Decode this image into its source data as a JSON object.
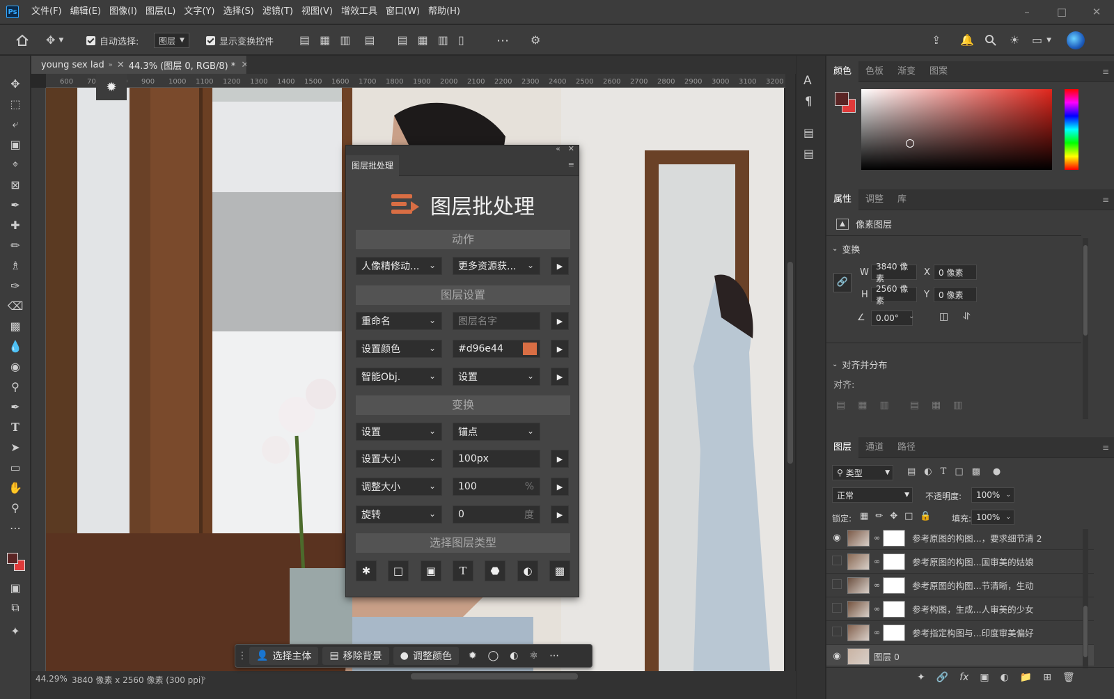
{
  "menubar": {
    "items": [
      "文件(F)",
      "编辑(E)",
      "图像(I)",
      "图层(L)",
      "文字(Y)",
      "选择(S)",
      "滤镜(T)",
      "视图(V)",
      "增效工具",
      "窗口(W)",
      "帮助(H)"
    ],
    "logo": "Ps"
  },
  "options": {
    "auto_select_label": "自动选择:",
    "auto_select_value": "图层",
    "show_transform_label": "显示变换控件"
  },
  "document": {
    "tab_title": "young sex lad",
    "tab_suffix": "44.3% (图层 0, RGB/8) *",
    "ruler_ticks": [
      "600",
      "700",
      "800",
      "900",
      "1000",
      "1100",
      "1200",
      "1300",
      "1400",
      "1500",
      "1600",
      "1700",
      "1800",
      "1900",
      "2000",
      "2100",
      "2200",
      "2300",
      "2400",
      "2500",
      "2600",
      "2700",
      "2800",
      "2900",
      "3000",
      "3100",
      "3200"
    ],
    "zoom": "44.29%",
    "dimensions": "3840 像素 x 2560 像素 (300 ppi)"
  },
  "context_bar": {
    "select_subject": "选择主体",
    "remove_bg": "移除背景",
    "adjust_color": "调整颜色"
  },
  "plugin": {
    "tab": "图层批处理",
    "title": "图层批处理",
    "section_action": "动作",
    "action_dd1": "人像精修动...",
    "action_dd2": "更多资源获...",
    "section_layer": "图层设置",
    "rename_label": "重命名",
    "layer_name_placeholder": "图层名字",
    "set_color_label": "设置颜色",
    "color_value": "#d96e44",
    "color_swatch": "#d96e44",
    "smart_obj_label": "智能Obj.",
    "smart_obj_value": "设置",
    "section_transform": "变换",
    "transform_set": "设置",
    "anchor": "锚点",
    "set_size_label": "设置大小",
    "set_size_value": "100px",
    "resize_label": "调整大小",
    "resize_value": "100",
    "resize_unit": "%",
    "rotate_label": "旋转",
    "rotate_value": "0",
    "rotate_unit": "度",
    "section_select": "选择图层类型"
  },
  "color_panel": {
    "tabs": [
      "颜色",
      "色板",
      "渐变",
      "图案"
    ],
    "fg_color": "#5a2424",
    "bg_color": "#e03a3a"
  },
  "properties_panel": {
    "tabs": [
      "属性",
      "调整",
      "库"
    ],
    "layer_type": "像素图层",
    "transform_title": "变换",
    "w_label": "W",
    "w_value": "3840 像素",
    "h_label": "H",
    "h_value": "2560 像素",
    "x_label": "X",
    "x_value": "0 像素",
    "y_label": "Y",
    "y_value": "0 像素",
    "angle_value": "0.00°",
    "align_title": "对齐并分布",
    "align_label": "对齐:"
  },
  "layers_panel": {
    "tabs": [
      "图层",
      "通道",
      "路径"
    ],
    "filter_label": "类型",
    "blend_mode": "正常",
    "opacity_label": "不透明度:",
    "opacity_value": "100%",
    "lock_label": "锁定:",
    "fill_label": "填充:",
    "fill_value": "100%",
    "layers": [
      {
        "name": "参考原图的构图...，要求细节清 2",
        "visible": true
      },
      {
        "name": "参考原图的构图...国审美的姑娘",
        "visible": false
      },
      {
        "name": "参考原图的构图...节清晰，生动",
        "visible": false
      },
      {
        "name": "参考构图，生成...人审美的少女",
        "visible": false
      },
      {
        "name": "参考指定构图与...印度审美偏好",
        "visible": false
      },
      {
        "name": "图层 0",
        "visible": true
      }
    ]
  }
}
